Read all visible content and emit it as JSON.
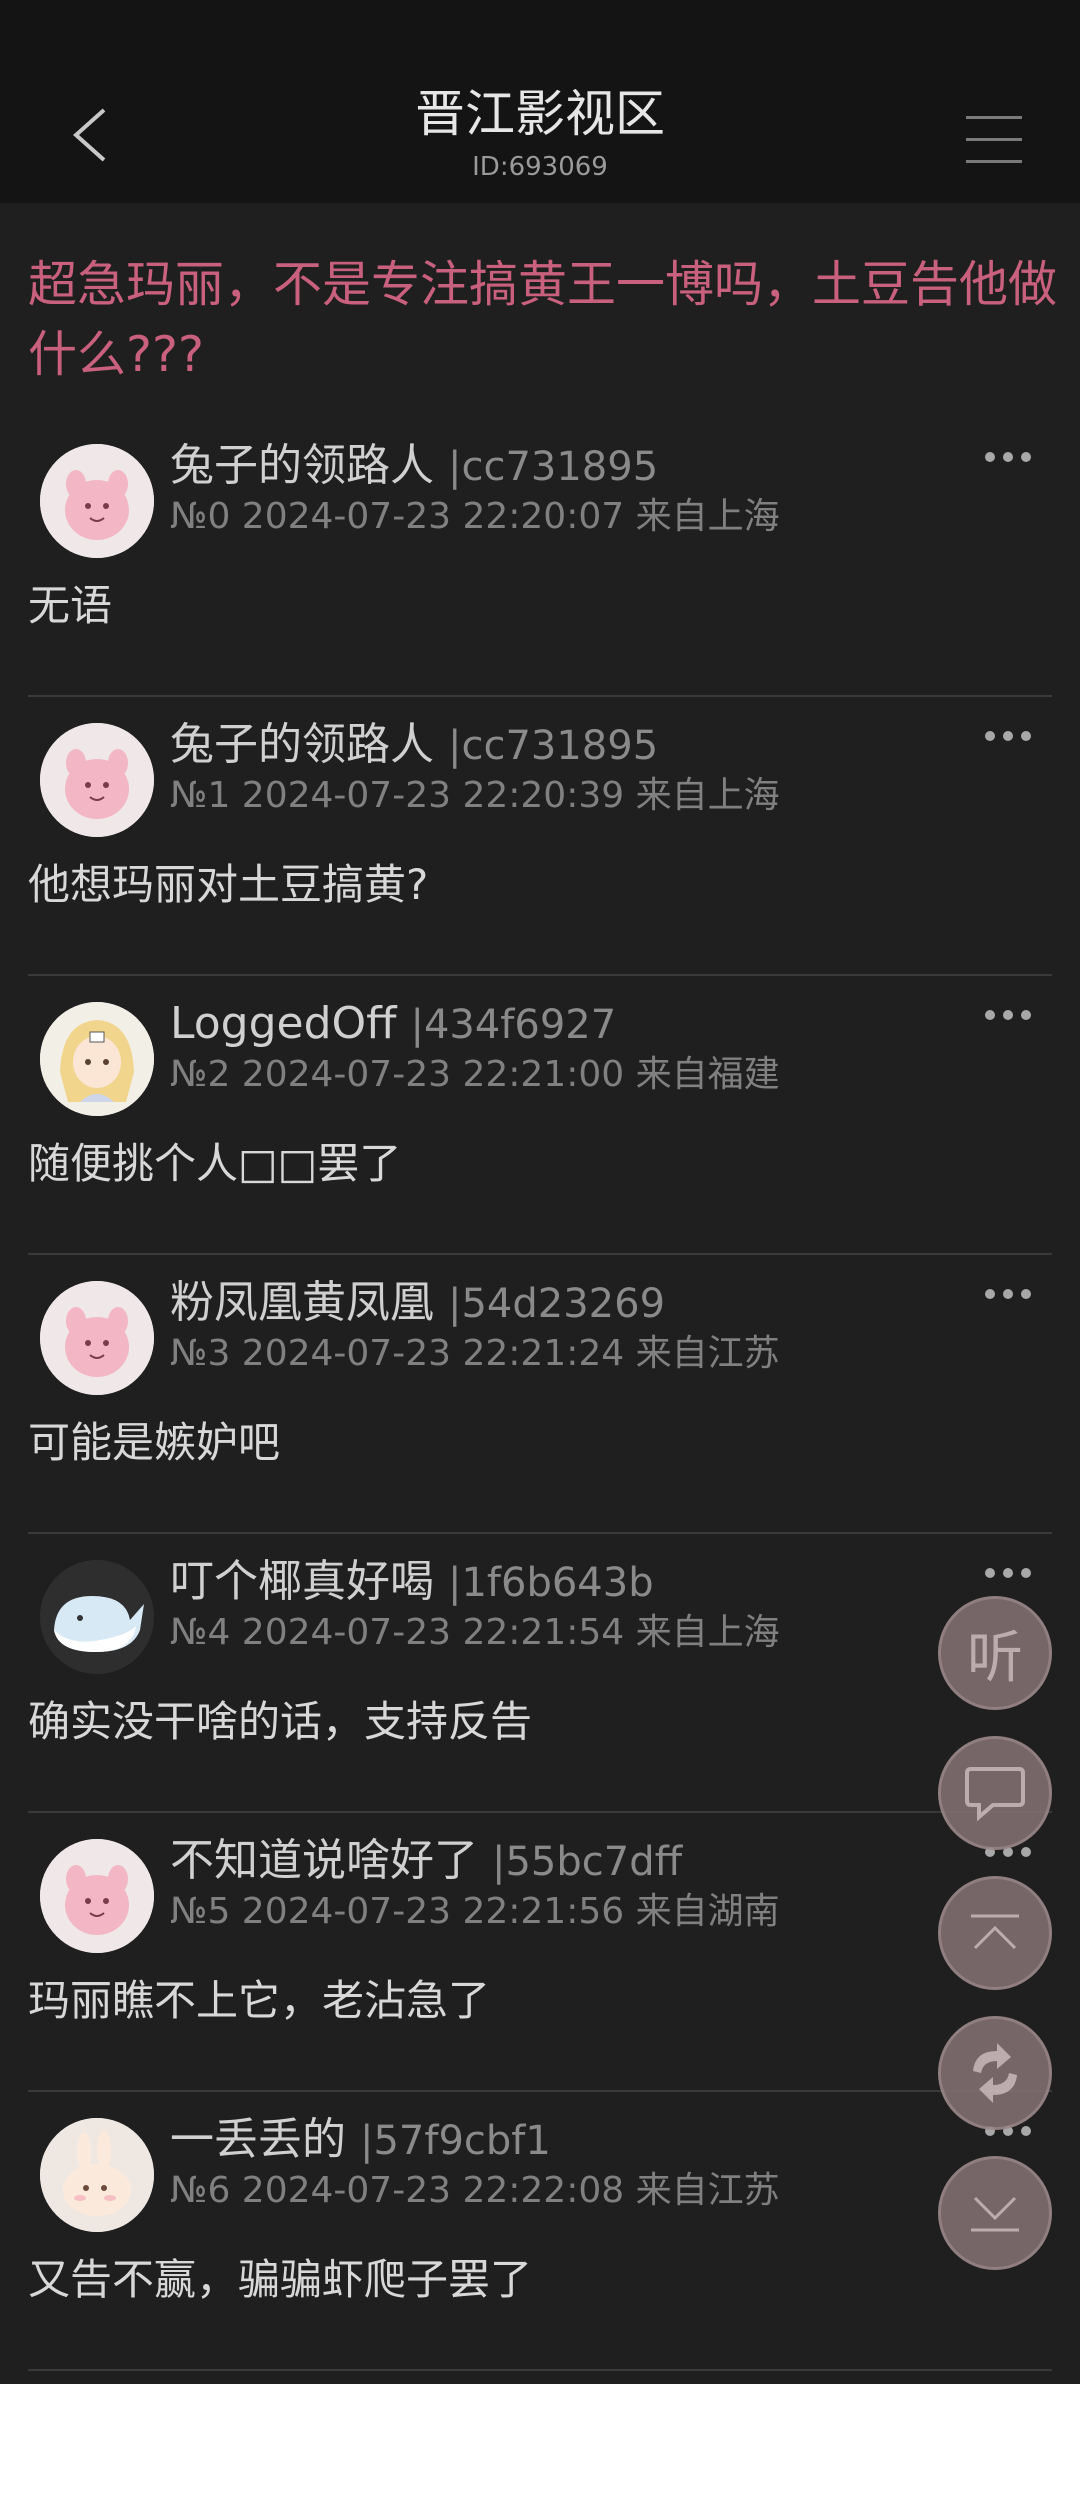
{
  "header": {
    "title": "晋江影视区",
    "subtitle": "ID:693069"
  },
  "thread": {
    "title": "超急玛丽，不是专注搞黄王一博吗，土豆告他做什么???"
  },
  "posts": [
    {
      "name": "兔子的领路人",
      "uid": "|cc731895",
      "meta": "№0 2024-07-23 22:20:07 来自上海",
      "content": "无语",
      "avatar_icon": "pink-pokemon-avatar-icon"
    },
    {
      "name": "兔子的领路人",
      "uid": "|cc731895",
      "meta": "№1 2024-07-23 22:20:39 来自上海",
      "content": "他想玛丽对土豆搞黄?",
      "avatar_icon": "pink-pokemon-avatar-icon"
    },
    {
      "name": "LoggedOff",
      "uid": "|434f6927",
      "meta": "№2 2024-07-23 22:21:00 来自福建",
      "content": "随便挑个人□□罢了",
      "avatar_icon": "anime-girl-avatar-icon"
    },
    {
      "name": "粉凤凰黄凤凰",
      "uid": "|54d23269",
      "meta": "№3 2024-07-23 22:21:24 来自江苏",
      "content": "可能是嫉妒吧",
      "avatar_icon": "pink-pokemon-avatar-icon"
    },
    {
      "name": "叮个椰真好喝",
      "uid": "|1f6b643b",
      "meta": "№4 2024-07-23 22:21:54 来自上海",
      "content": "确实没干啥的话，支持反告",
      "avatar_icon": "whale-avatar-icon"
    },
    {
      "name": "不知道说啥好了",
      "uid": "|55bc7dff",
      "meta": "№5 2024-07-23 22:21:56 来自湖南",
      "content": "玛丽瞧不上它，老沾急了",
      "avatar_icon": "pink-pokemon-avatar-icon"
    },
    {
      "name": "一丢丢的",
      "uid": "|57f9cbf1",
      "meta": "№6 2024-07-23 22:22:08 来自江苏",
      "content": "又告不赢，骗骗虾爬子罢了",
      "avatar_icon": "bunny-avatar-icon"
    }
  ],
  "floating": {
    "listen_label": "听",
    "comment_icon": "comment-icon",
    "top_icon": "scroll-top-icon",
    "refresh_icon": "refresh-icon",
    "bottom_icon": "scroll-bottom-icon"
  },
  "colors": {
    "background": "#1f1f1f",
    "header_bg": "#141414",
    "thread_title": "#c9607d",
    "fab": "#7e6d6f"
  }
}
